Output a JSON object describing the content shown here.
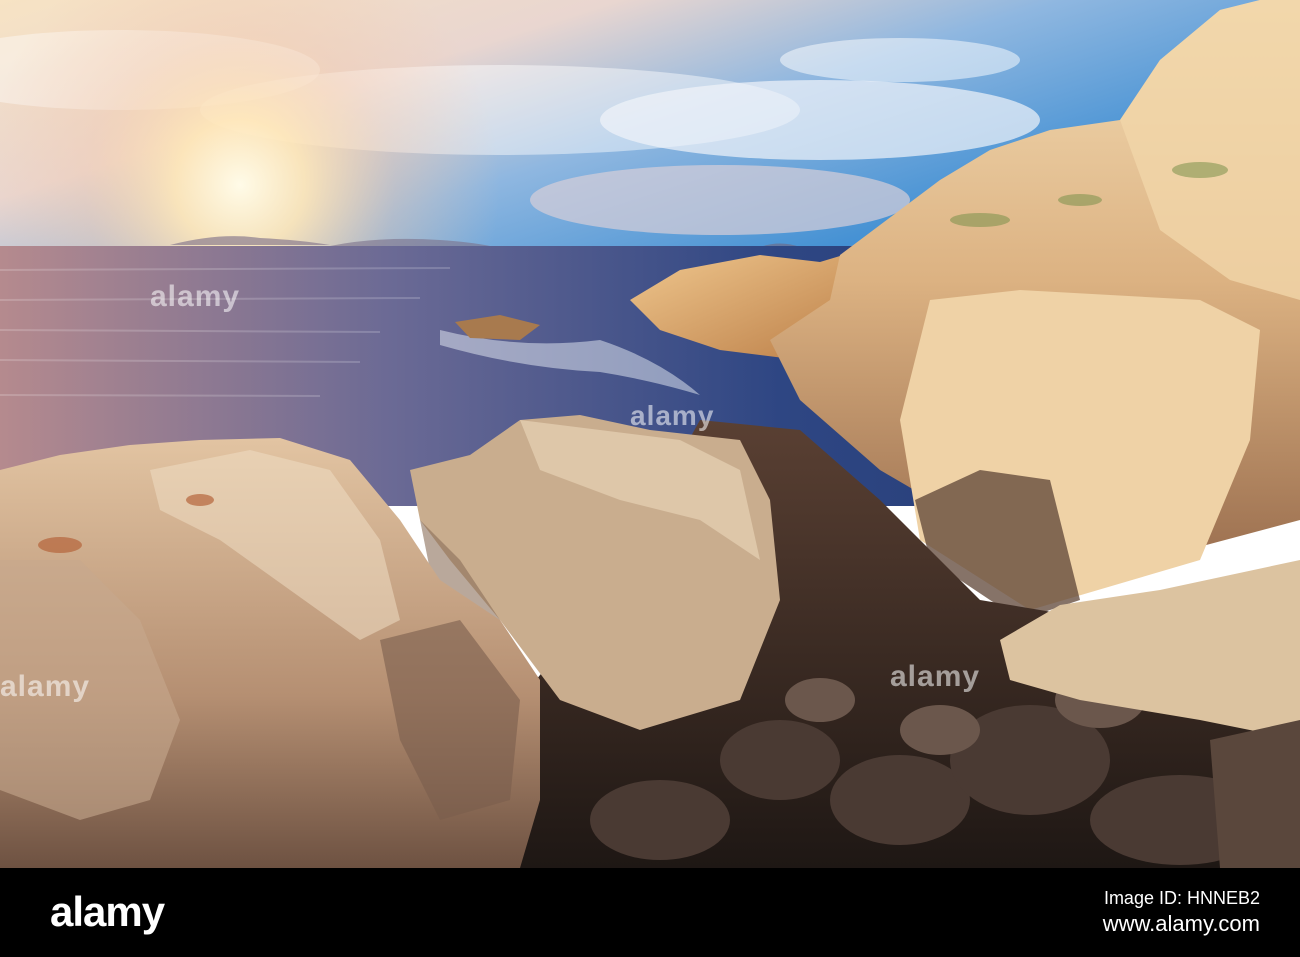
{
  "photo": {
    "subject": "rocky sea coast at sunset",
    "colors": {
      "sky_top": "#3b8fd4",
      "sky_glow": "#fbe7c8",
      "sea": "#3a4f8a",
      "rock_light": "#e8c79a",
      "rock_dark": "#2a1f1c"
    }
  },
  "watermark": {
    "text": "alamy"
  },
  "footer": {
    "logo": "alamy",
    "image_id": "Image ID: HNNEB2",
    "url": "www.alamy.com"
  }
}
